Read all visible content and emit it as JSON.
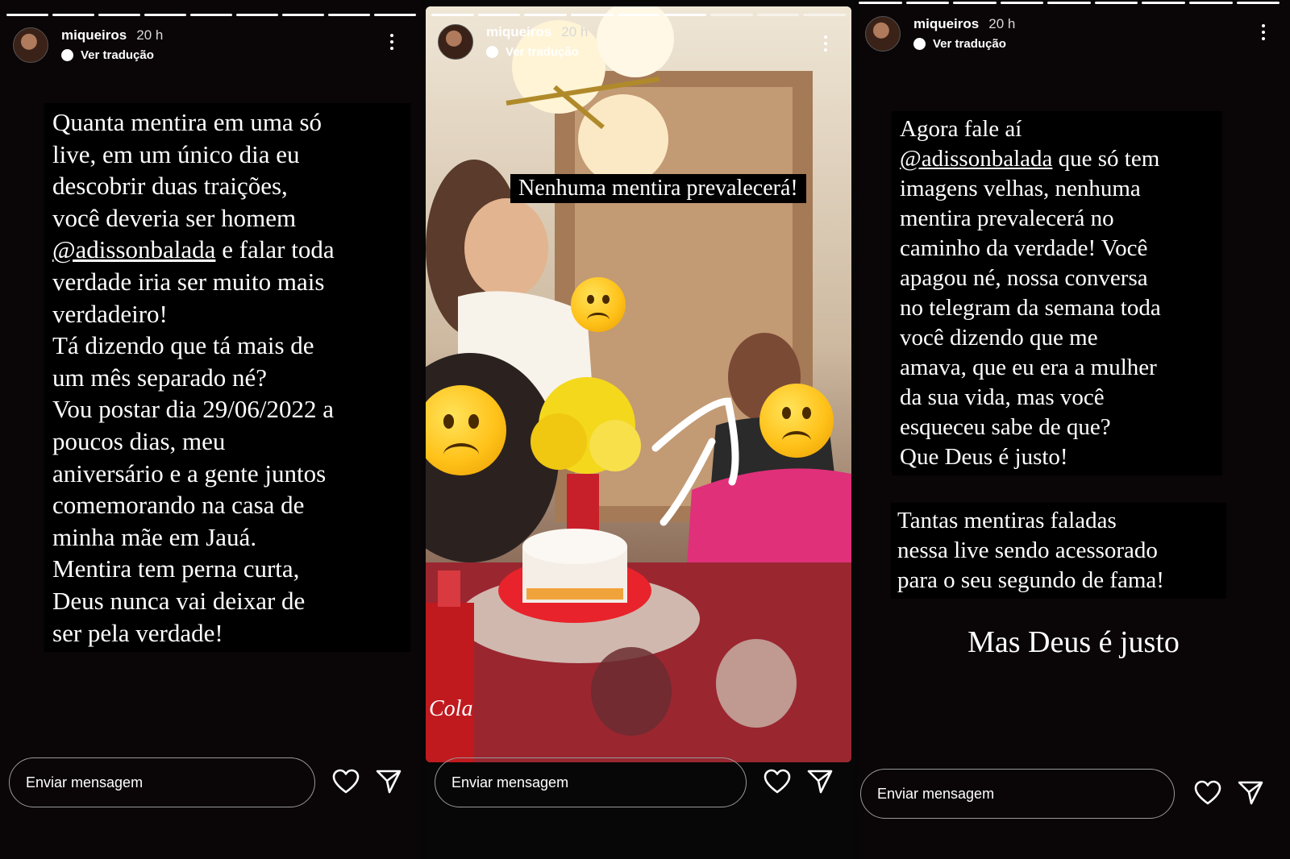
{
  "story_header": {
    "username": "miqueiros",
    "time": "20 h",
    "translate_label": "Ver tradução"
  },
  "footer": {
    "message_placeholder": "Enviar mensagem"
  },
  "panel1": {
    "text_before_mention": "Quanta mentira em uma só\nlive, em um único dia eu\ndescobrir duas traições,\nvocê deveria ser homem\n",
    "mention": "@adissonbalada",
    "text_after_mention": " e falar toda\nverdade iria ser muito mais\nverdadeiro!\nTá dizendo que tá mais de\num mês separado né?\nVou postar dia 29/06/2022 a\npoucos dias,  meu\naniversário e a gente juntos\ncomemorando na casa de\nminha mãe em Jauá.\nMentira tem perna curta,\nDeus nunca vai deixar de\nser pela verdade!"
  },
  "panel2": {
    "caption": "Nenhuma mentira prevalecerá!",
    "bottle_label": "Cola"
  },
  "panel3": {
    "block1_before_mention": "Agora fale aí\n",
    "mention": "@adissonbalada",
    "block1_after_mention": " que só tem\nimagens velhas, nenhuma\nmentira prevalecerá no\ncaminho da verdade! Você\napagou né, nossa conversa\nno telegram da semana toda\nvocê dizendo que me\namava, que eu era a mulher\nda sua vida, mas você\nesqueceu sabe de que?\nQue Deus é justo!",
    "block2": "Tantas mentiras faladas\nnessa live sendo acessorado\npara o seu segundo de fama!",
    "block3": "Mas Deus é justo"
  },
  "icons": {
    "heart": "heart-icon",
    "send": "send-icon",
    "more": "more-options-icon",
    "translate": "translate-icon"
  }
}
